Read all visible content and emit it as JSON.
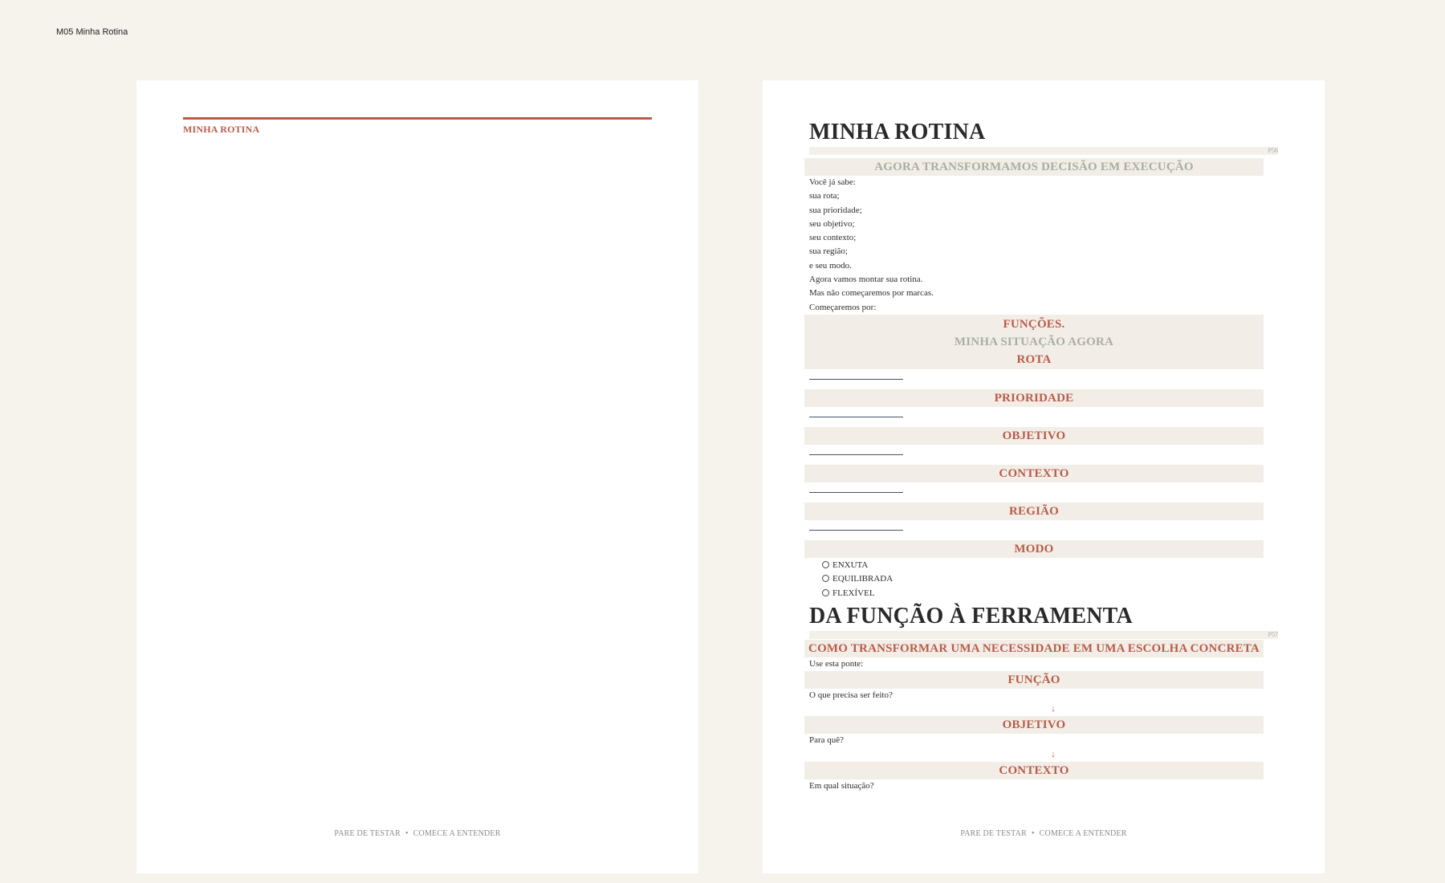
{
  "document": {
    "label": "M05 Minha Rotina"
  },
  "left_page": {
    "title": "MINHA ROTINA",
    "footer": {
      "left": "PARE DE TESTAR",
      "separator": "•",
      "right": "COMECE A ENTENDER"
    }
  },
  "right_page": {
    "section1": {
      "title": "MINHA ROTINA",
      "page_number": "P56",
      "subtitle": "AGORA TRANSFORMAMOS DECISÃO EM EXECUÇÃO",
      "intro_lines": [
        "Você já sabe:",
        "sua rota;",
        "sua prioridade;",
        "seu objetivo;",
        "seu contexto;",
        "sua região;",
        "e seu modo.",
        "Agora vamos montar sua rotina.",
        "Mas não começaremos por marcas.",
        "Começaremos por:"
      ],
      "band_lines": [
        "FUNÇÕES.",
        "MINHA SITUAÇÃO AGORA",
        "ROTA"
      ],
      "fields": [
        "PRIORIDADE",
        "OBJETIVO",
        "CONTEXTO",
        "REGIÃO"
      ],
      "mode_label": "MODO",
      "mode_options": [
        "ENXUTA",
        "EQUILIBRADA",
        "FLEXÍVEL"
      ]
    },
    "section2": {
      "title": "DA FUNÇÃO À FERRAMENTA",
      "page_number": "P57",
      "subtitle": "COMO TRANSFORMAR UMA NECESSIDADE EM UMA ESCOLHA CONCRETA",
      "lead": "Use esta ponte:",
      "steps": [
        {
          "label": "FUNÇÃO",
          "question": "O que precisa ser feito?"
        },
        {
          "label": "OBJETIVO",
          "question": "Para quê?"
        },
        {
          "label": "CONTEXTO",
          "question": "Em qual situação?"
        }
      ],
      "arrow": "↓"
    },
    "footer": {
      "left": "PARE DE TESTAR",
      "separator": "•",
      "right": "COMECE A ENTENDER"
    }
  },
  "colors": {
    "accent": "#b85c48",
    "muted": "#a7b0a0",
    "band": "#f2ede7",
    "background": "#f6f3ed"
  }
}
